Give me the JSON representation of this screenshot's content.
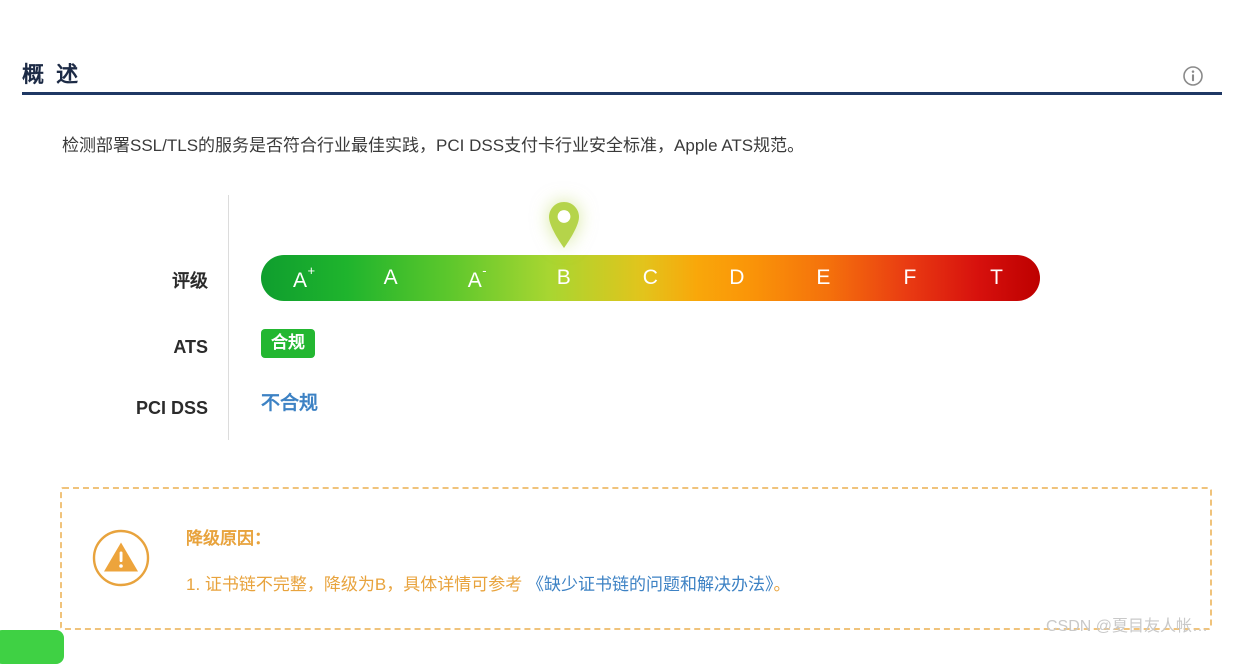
{
  "header": {
    "title": "概 述",
    "info_icon": "info-circle-icon",
    "rule_color": "#1f3864"
  },
  "description": "检测部署SSL/TLS的服务是否符合行业最佳实践，PCI DSS支付卡行业安全标准，Apple ATS规范。",
  "summary": {
    "rows": [
      {
        "label": "评级"
      },
      {
        "label": "ATS"
      },
      {
        "label": "PCI DSS"
      }
    ],
    "rating": {
      "grades": [
        "A",
        "A",
        "A",
        "B",
        "C",
        "D",
        "E",
        "F",
        "T"
      ],
      "grade_labels": [
        "A+",
        "A",
        "A-",
        "B",
        "C",
        "D",
        "E",
        "F",
        "T"
      ],
      "superscripts": [
        "+",
        "",
        "-",
        "",
        "",
        "",
        "",
        "",
        ""
      ],
      "current": "B",
      "current_index": 3,
      "marker_icon": "map-pin-marker-icon",
      "marker_color": "#b5d44a",
      "gradient_start": "#0f9e2e",
      "gradient_end": "#bd0000"
    },
    "ats": {
      "value": "合规",
      "badge_color": "#23b731",
      "text_color": "#ffffff"
    },
    "pci_dss": {
      "value": "不合规",
      "text_color": "#3d82c4"
    }
  },
  "warning": {
    "icon": "warning-triangle-circle-icon",
    "accent_color": "#e8a33d",
    "title": "降级原因：",
    "reason_prefix": "1. 证书链不完整，降级为B，具体详情可参考",
    "reason_link": "《缺少证书链的问题和解决办法》",
    "reason_suffix": "。",
    "link_color": "#3d82c4"
  },
  "watermark": "CSDN @夏目友人帐…"
}
